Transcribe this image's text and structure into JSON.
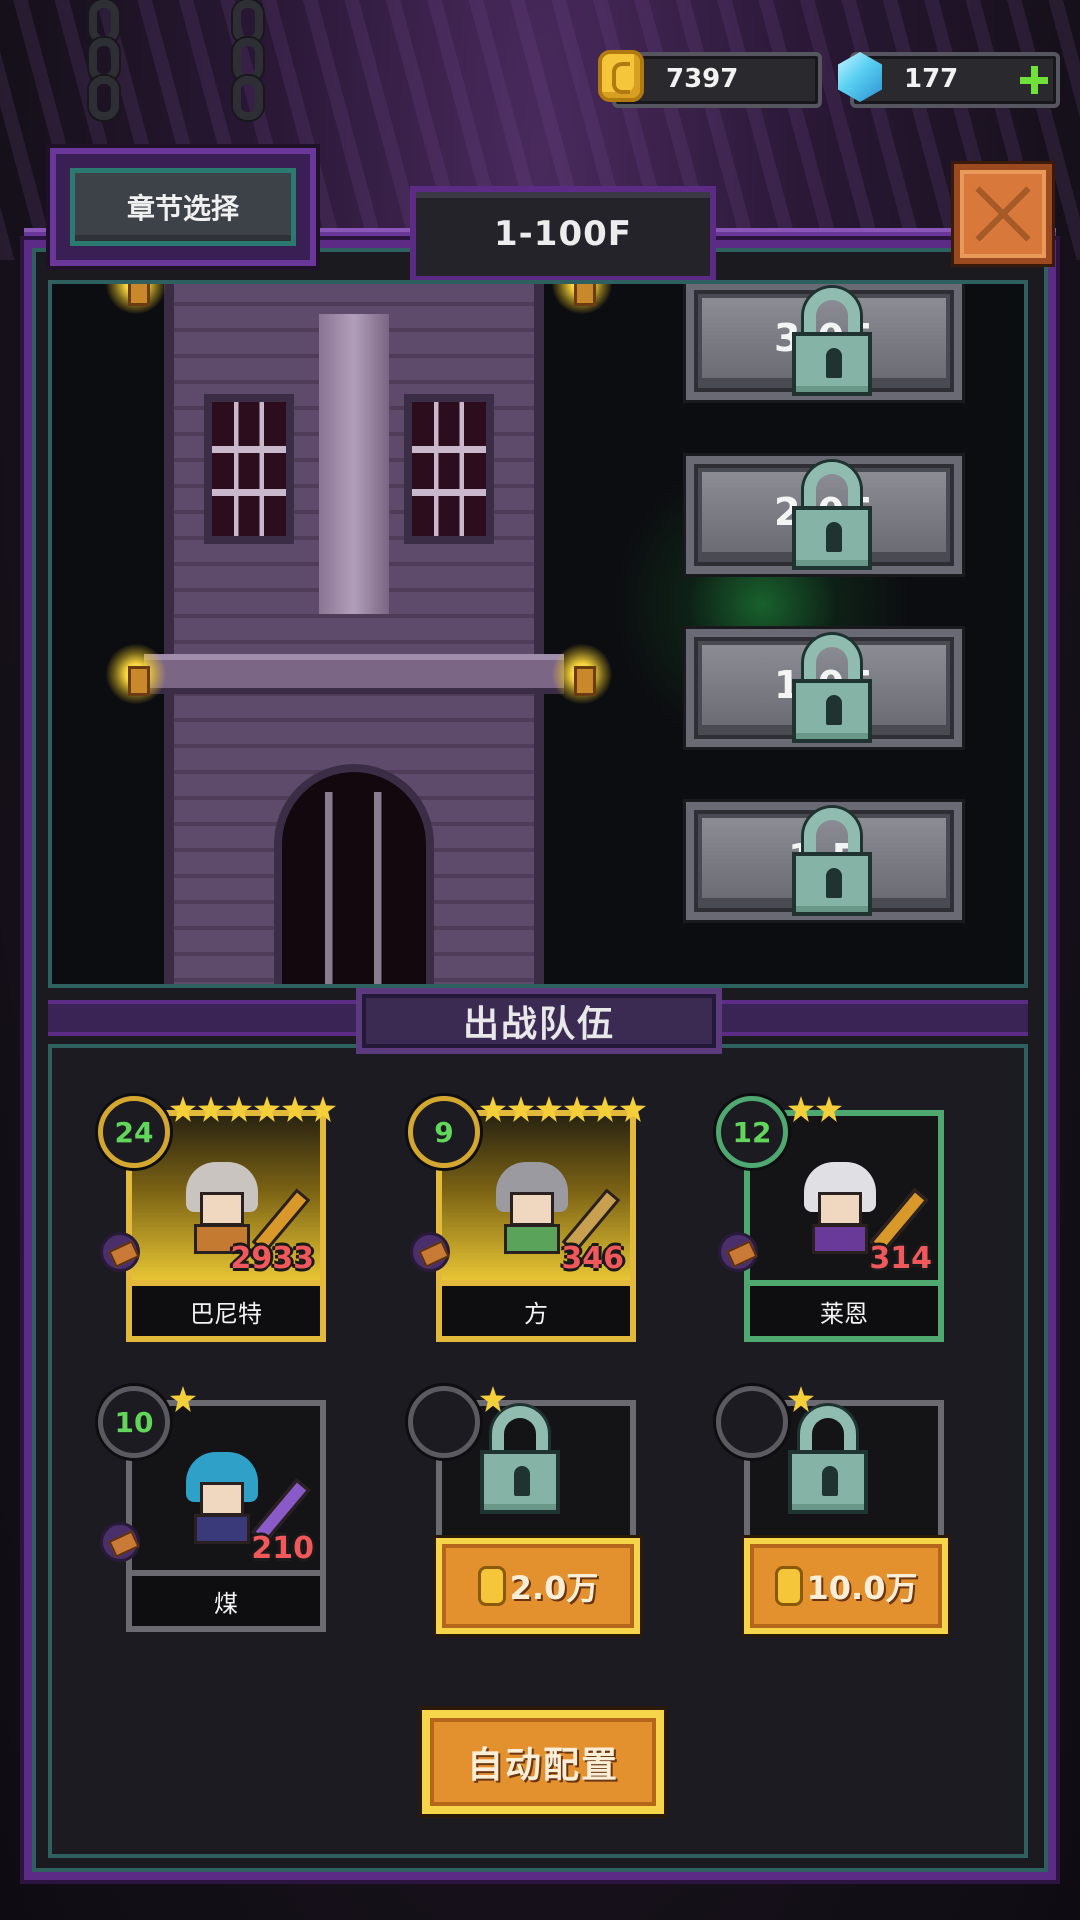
{
  "currency": {
    "coins": "7397",
    "gems": "177",
    "coin_icon": "gold-coin-icon",
    "gem_icon": "blue-gem-icon",
    "add_icon": "plus-icon"
  },
  "header": {
    "chapter_select_label": "章节选择",
    "floor_range": "1-100F",
    "close_icon": "close-x-icon"
  },
  "floors": {
    "items": [
      {
        "label": "3 0F",
        "locked": true
      },
      {
        "label": "2 0F",
        "locked": true
      },
      {
        "label": "1 0F",
        "locked": true
      },
      {
        "label": "1 F",
        "locked": true
      }
    ]
  },
  "team": {
    "title": "出战队伍",
    "members": [
      {
        "level": "24",
        "stars": 6,
        "power": "2933",
        "name": "巴尼特"
      },
      {
        "level": "9",
        "stars": 6,
        "power": "346",
        "name": "方"
      },
      {
        "level": "12",
        "stars": 2,
        "power": "314",
        "name": "莱恩"
      },
      {
        "level": "10",
        "stars": 1,
        "power": "210",
        "name": "煤"
      }
    ],
    "locked_slots": [
      {
        "stars": 1,
        "price": "2.0万"
      },
      {
        "stars": 1,
        "price": "10.0万"
      }
    ],
    "auto_config_label": "自动配置"
  },
  "colors": {
    "frame_purple": "#5b2b86",
    "gold_border": "#e2b93a",
    "green_border": "#4fa870",
    "power_red": "#f0585c",
    "level_green": "#62d65a",
    "button_orange": "#e3902e"
  }
}
